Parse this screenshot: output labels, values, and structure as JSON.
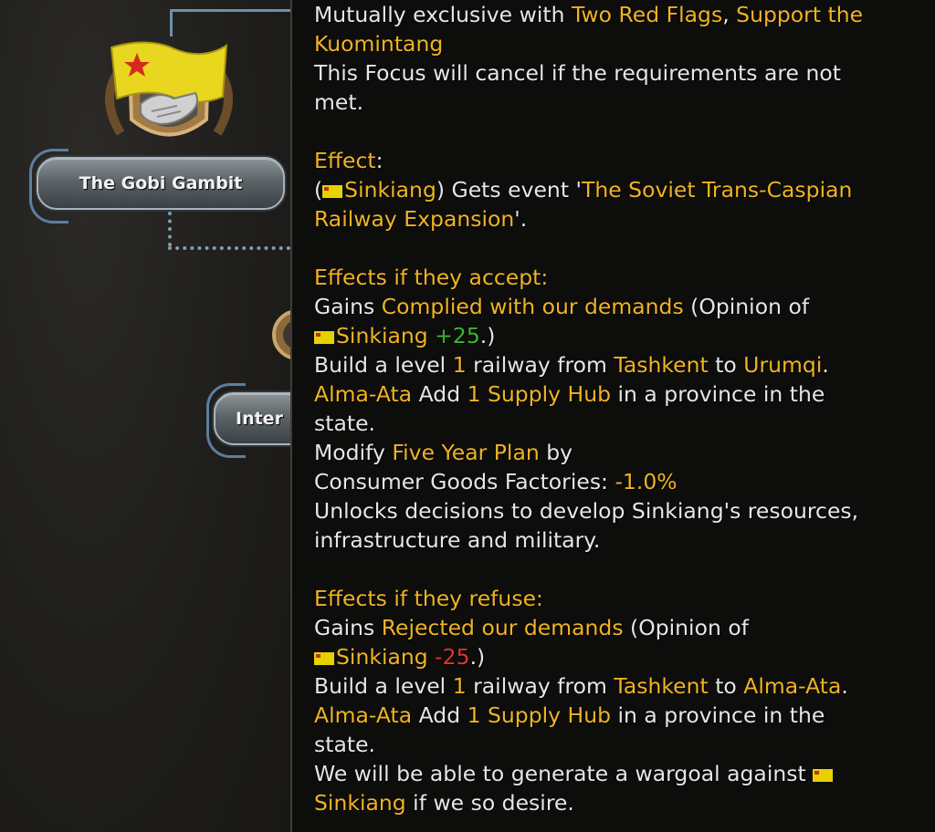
{
  "tree": {
    "focus1_label": "The Gobi Gambit",
    "focus2_label": "Inter"
  },
  "tooltip": {
    "l1a": "Mutually exclusive with ",
    "l1b": "Two Red Flags",
    "l1c": ", ",
    "l1d": "Support the",
    "l2": "Kuomintang",
    "l3": "This Focus will cancel if the requirements are not",
    "l4": "met.",
    "effect_hdr": "Effect",
    "effect_colon": ":",
    "e1a": "(",
    "e1b": "Sinkiang",
    "e1c": ") Gets event '",
    "e1d": "The Soviet Trans-Caspian",
    "e2a": "Railway Expansion",
    "e2b": "'.",
    "accept_hdr": "Effects if they accept:",
    "a1a": "Gains ",
    "a1b": "Complied with our demands",
    "a1c": " (Opinion of",
    "a2a": "Sinkiang",
    "a2b": " +25",
    "a2c": ".)",
    "a3a": "Build a level ",
    "a3b": "1",
    "a3c": " railway from ",
    "a3d": "Tashkent",
    "a3e": " to ",
    "a3f": "Urumqi",
    "a3g": ".",
    "a4a": "Alma-Ata",
    "a4b": " Add ",
    "a4c": "1 Supply Hub",
    "a4d": " in a province in the",
    "a5": "state.",
    "a6a": "Modify ",
    "a6b": "Five Year Plan",
    "a6c": " by",
    "a7a": "Consumer Goods Factories: ",
    "a7b": "-1.0%",
    "a8": "Unlocks decisions to develop Sinkiang's resources,",
    "a9": "infrastructure and military.",
    "refuse_hdr": "Effects if they refuse:",
    "r1a": "Gains ",
    "r1b": "Rejected our demands",
    "r1c": " (Opinion of",
    "r2a": "Sinkiang",
    "r2b": " -25",
    "r2c": ".)",
    "r3a": "Build a level ",
    "r3b": "1",
    "r3c": " railway from ",
    "r3d": "Tashkent",
    "r3e": " to ",
    "r3f": "Alma-Ata",
    "r3g": ".",
    "r4a": "Alma-Ata",
    "r4b": " Add ",
    "r4c": "1 Supply Hub",
    "r4d": " in a province in the",
    "r5": "state.",
    "r6": "We will be able to generate a wargoal against ",
    "r7a": "Sinkiang",
    "r7b": " if we so desire."
  },
  "colors": {
    "highlight": "#f0b323",
    "positive": "#37b82e",
    "negative": "#e0352f",
    "text": "#e6e6e6",
    "connector": "#6f8fa6"
  },
  "icons": {
    "focus1": "yellow-flag-handshake-icon",
    "focus2": "round-emblem-icon",
    "country_flag": "sinkiang-flag-icon"
  }
}
